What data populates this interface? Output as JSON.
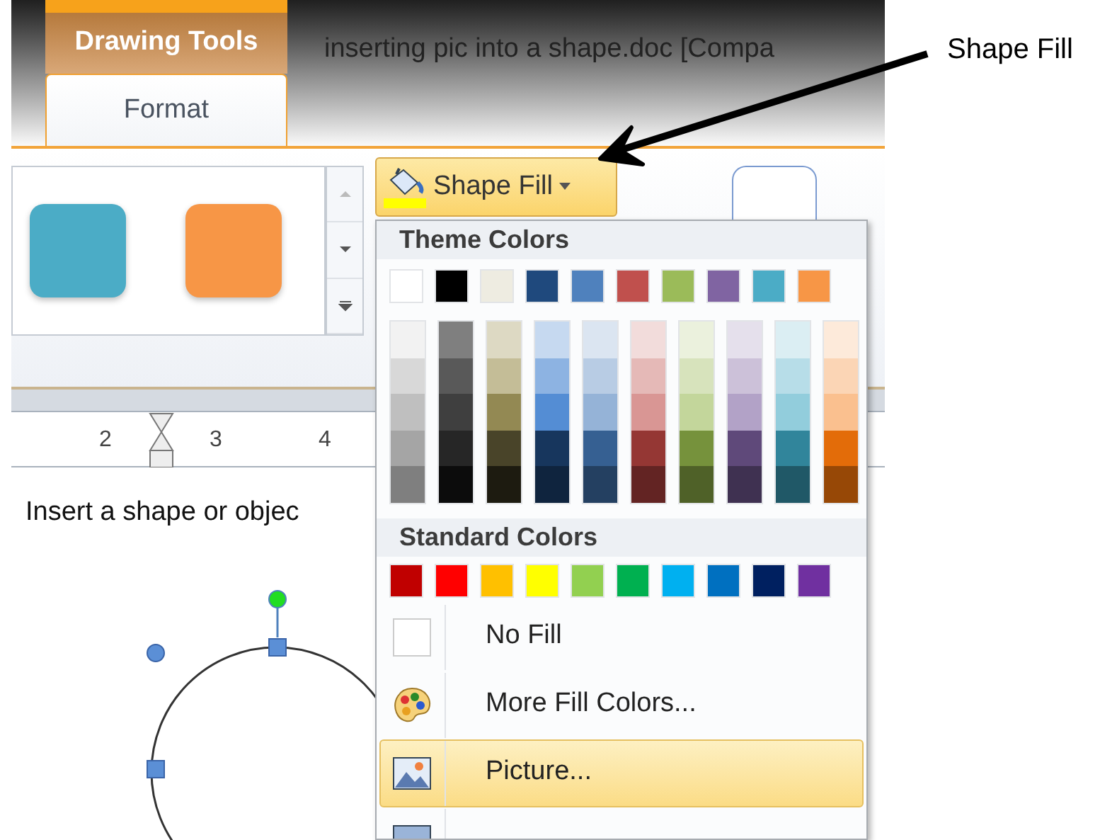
{
  "window": {
    "title": "inserting pic into a shape.doc [Compa"
  },
  "contextual_tab_group": {
    "label": "Drawing Tools"
  },
  "tabs": [
    {
      "label": "Format",
      "selected": true
    }
  ],
  "shape_styles": [
    {
      "color": "#4bacc6"
    },
    {
      "color": "#f79646"
    },
    {
      "color": "#ffffff"
    }
  ],
  "shape_fill_button": {
    "label": "Shape Fill",
    "color": "#ffff00",
    "selected": true
  },
  "ruler": {
    "numbers": [
      "2",
      "3",
      "4"
    ]
  },
  "document": {
    "text": "Insert a shape or objec",
    "shape": {
      "selected": true
    }
  },
  "shape_fill_menu": {
    "theme_colors": {
      "title": "Theme Colors",
      "columns": [
        {
          "color": "#ffffff",
          "shades": [
            {
              "color": "#f2f2f2"
            },
            {
              "color": "#d8d8d8"
            },
            {
              "color": "#bfbfbf"
            },
            {
              "color": "#a5a5a5"
            },
            {
              "color": "#7f7f7f"
            }
          ]
        },
        {
          "color": "#000000",
          "shades": [
            {
              "color": "#7f7f7f"
            },
            {
              "color": "#595959"
            },
            {
              "color": "#3f3f3f"
            },
            {
              "color": "#262626"
            },
            {
              "color": "#0c0c0c"
            }
          ]
        },
        {
          "color": "#eeece1",
          "shades": [
            {
              "color": "#ddd9c3"
            },
            {
              "color": "#c4bd97"
            },
            {
              "color": "#938953"
            },
            {
              "color": "#494429"
            },
            {
              "color": "#1d1b10"
            }
          ]
        },
        {
          "color": "#1f497d",
          "shades": [
            {
              "color": "#c6d9f0"
            },
            {
              "color": "#8db3e2"
            },
            {
              "color": "#548dd4"
            },
            {
              "color": "#17365d"
            },
            {
              "color": "#0f243e"
            }
          ]
        },
        {
          "color": "#4f81bd",
          "shades": [
            {
              "color": "#dbe5f1"
            },
            {
              "color": "#b8cce4"
            },
            {
              "color": "#95b3d7"
            },
            {
              "color": "#366092"
            },
            {
              "color": "#244061"
            }
          ]
        },
        {
          "color": "#c0504d",
          "shades": [
            {
              "color": "#f2dcdb"
            },
            {
              "color": "#e5b9b7"
            },
            {
              "color": "#d99694"
            },
            {
              "color": "#953734"
            },
            {
              "color": "#632423"
            }
          ]
        },
        {
          "color": "#9bbb59",
          "shades": [
            {
              "color": "#ebf1dd"
            },
            {
              "color": "#d7e3bc"
            },
            {
              "color": "#c3d69b"
            },
            {
              "color": "#76923c"
            },
            {
              "color": "#4f6128"
            }
          ]
        },
        {
          "color": "#8064a2",
          "shades": [
            {
              "color": "#e5e0ec"
            },
            {
              "color": "#ccc1d9"
            },
            {
              "color": "#b2a2c7"
            },
            {
              "color": "#5f497a"
            },
            {
              "color": "#3f3151"
            }
          ]
        },
        {
          "color": "#4bacc6",
          "shades": [
            {
              "color": "#dbeef3"
            },
            {
              "color": "#b7dde8"
            },
            {
              "color": "#92cddc"
            },
            {
              "color": "#31859b"
            },
            {
              "color": "#205867"
            }
          ]
        },
        {
          "color": "#f79646",
          "shades": [
            {
              "color": "#fdeada"
            },
            {
              "color": "#fbd5b5"
            },
            {
              "color": "#fac08f"
            },
            {
              "color": "#e36c09"
            },
            {
              "color": "#974806"
            }
          ]
        }
      ]
    },
    "standard_colors": {
      "title": "Standard Colors",
      "colors": [
        {
          "color": "#c00000"
        },
        {
          "color": "#ff0000"
        },
        {
          "color": "#ffc000"
        },
        {
          "color": "#ffff00"
        },
        {
          "color": "#92d050"
        },
        {
          "color": "#00b050"
        },
        {
          "color": "#00b0f0"
        },
        {
          "color": "#0070c0"
        },
        {
          "color": "#002060"
        },
        {
          "color": "#7030a0"
        }
      ]
    },
    "items": [
      {
        "kind": "swatch",
        "label": "No Fill",
        "selected": false
      },
      {
        "kind": "palette",
        "label": "More Fill Colors...",
        "selected": false
      },
      {
        "kind": "picture",
        "label": "Picture...",
        "selected": true
      },
      {
        "kind": "texture",
        "selected": false
      }
    ]
  },
  "annotation": {
    "label": "Shape Fill"
  }
}
